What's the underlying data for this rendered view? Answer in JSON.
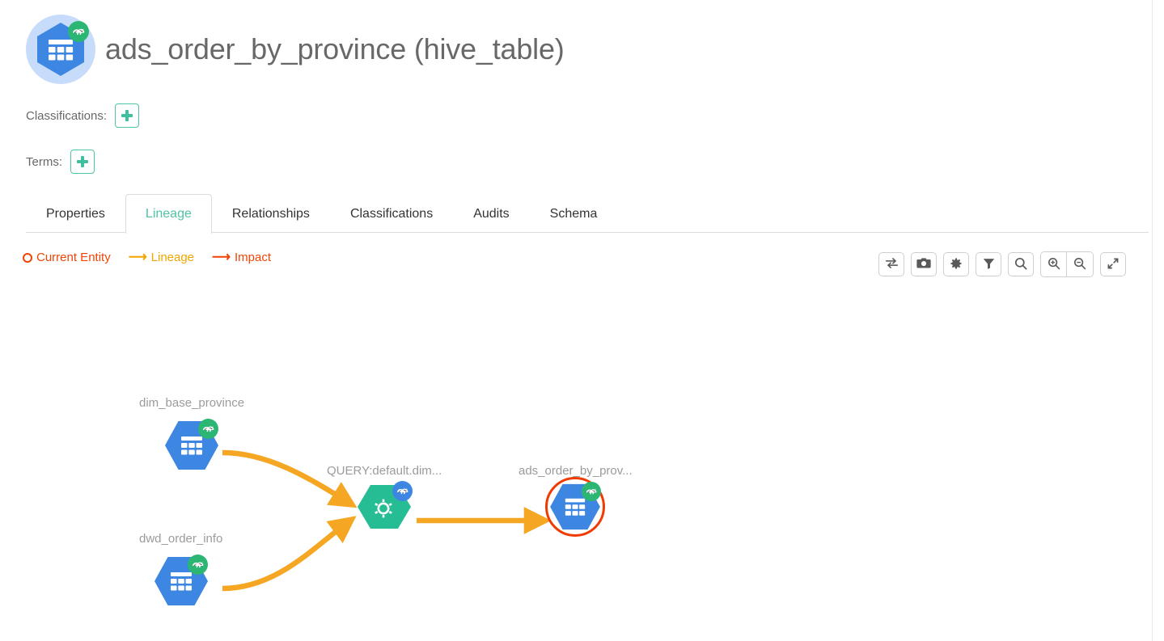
{
  "header": {
    "title": "ads_order_by_province (hive_table)",
    "avatar_icon": "hive-table-hexagon-icon",
    "avatar_badge_icon": "hive-elephant-badge-icon"
  },
  "meta": {
    "classifications_label": "Classifications:",
    "classifications_add_icon": "plus-icon",
    "terms_label": "Terms:",
    "terms_add_icon": "plus-icon"
  },
  "tabs": [
    {
      "label": "Properties",
      "active": false
    },
    {
      "label": "Lineage",
      "active": true
    },
    {
      "label": "Relationships",
      "active": false
    },
    {
      "label": "Classifications",
      "active": false
    },
    {
      "label": "Audits",
      "active": false
    },
    {
      "label": "Schema",
      "active": false
    }
  ],
  "legend": [
    {
      "label": "Current Entity",
      "icon": "circle-outline-icon",
      "color": "#f24405"
    },
    {
      "label": "Lineage",
      "icon": "arrow-right-icon",
      "color": "#f0a500"
    },
    {
      "label": "Impact",
      "icon": "arrow-right-icon",
      "color": "#f24405"
    }
  ],
  "toolbar": [
    {
      "name": "swap-lineage-direction-button",
      "icon": "retweet-icon"
    },
    {
      "name": "screenshot-button",
      "icon": "camera-icon"
    },
    {
      "name": "settings-button",
      "icon": "gear-icon"
    },
    {
      "name": "filter-button",
      "icon": "filter-icon"
    },
    {
      "name": "search-button",
      "icon": "search-icon"
    },
    {
      "name": "zoom-in-button",
      "icon": "zoom-in-icon"
    },
    {
      "name": "zoom-out-button",
      "icon": "zoom-out-icon"
    },
    {
      "name": "fullscreen-button",
      "icon": "fullscreen-icon"
    }
  ],
  "graph": {
    "nodes": [
      {
        "id": "dim_base_province",
        "label": "dim_base_province",
        "type": "hive_table",
        "icon": "hive-table-hexagon-icon",
        "badge_icon": "hive-elephant-badge-icon",
        "selected": false
      },
      {
        "id": "dwd_order_info",
        "label": "dwd_order_info",
        "type": "hive_table",
        "icon": "hive-table-hexagon-icon",
        "badge_icon": "hive-elephant-badge-icon",
        "selected": false
      },
      {
        "id": "query_process",
        "label": "QUERY:default.dim...",
        "type": "hive_process",
        "icon": "process-gear-hexagon-icon",
        "badge_icon": "hive-elephant-badge-icon",
        "selected": false
      },
      {
        "id": "ads_order_by_province",
        "label": "ads_order_by_prov...",
        "type": "hive_table",
        "icon": "hive-table-hexagon-icon",
        "badge_icon": "hive-elephant-badge-icon",
        "selected": true
      }
    ],
    "edges": [
      {
        "from": "dim_base_province",
        "to": "query_process",
        "color": "#f5a623"
      },
      {
        "from": "dwd_order_info",
        "to": "query_process",
        "color": "#f5a623"
      },
      {
        "from": "query_process",
        "to": "ads_order_by_province",
        "color": "#f5a623"
      }
    ]
  },
  "colors": {
    "table_node": "#3d87e3",
    "process_node": "#27bd94",
    "badge_green": "#2bb673",
    "badge_blue": "#3d87e3",
    "edge": "#f5a623",
    "selection_ring": "#f03c02",
    "tab_active": "#4ec3a5"
  }
}
